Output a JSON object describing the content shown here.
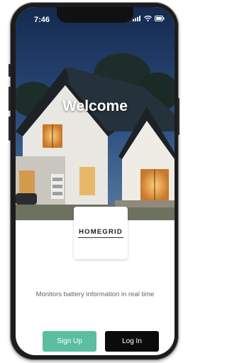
{
  "status_bar": {
    "time": "7:46",
    "signal_icon": "signal-bars-icon",
    "wifi_icon": "wifi-icon",
    "battery_icon": "battery-icon"
  },
  "hero": {
    "title": "Welcome",
    "image": "modern house at dusk"
  },
  "logo": {
    "text": "HOMEGRID"
  },
  "tagline": "Monitors battery information in real time",
  "buttons": {
    "signup": "Sign Up",
    "login": "Log In"
  },
  "colors": {
    "signup": "#5bbf9f",
    "login": "#0b0b0b",
    "tagline": "#666666"
  }
}
